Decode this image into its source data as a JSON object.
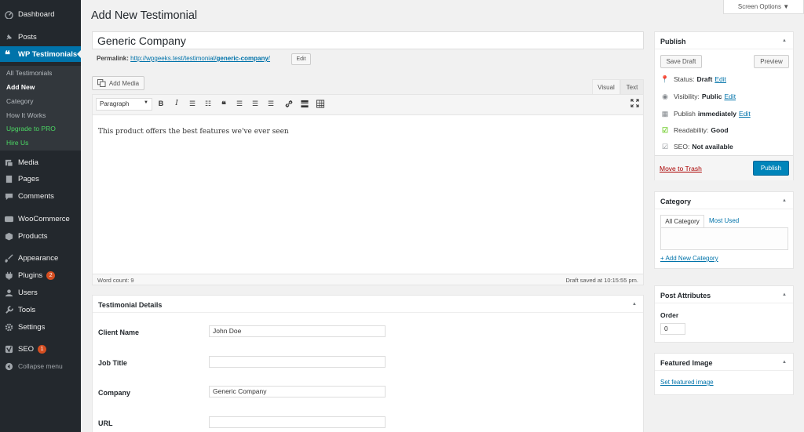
{
  "sidebar": {
    "items": [
      {
        "label": "Dashboard",
        "icon": "dashboard-icon"
      },
      {
        "label": "Posts",
        "icon": "pin-icon"
      },
      {
        "label": "WP Testimonials",
        "icon": "quote-icon"
      },
      {
        "label": "Media",
        "icon": "media-icon"
      },
      {
        "label": "Pages",
        "icon": "page-icon"
      },
      {
        "label": "Comments",
        "icon": "comment-icon"
      },
      {
        "label": "WooCommerce",
        "icon": "woo-icon"
      },
      {
        "label": "Products",
        "icon": "box-icon"
      },
      {
        "label": "Appearance",
        "icon": "brush-icon"
      },
      {
        "label": "Plugins",
        "icon": "plug-icon",
        "badge": "2"
      },
      {
        "label": "Users",
        "icon": "user-icon"
      },
      {
        "label": "Tools",
        "icon": "wrench-icon"
      },
      {
        "label": "Settings",
        "icon": "settings-icon"
      },
      {
        "label": "SEO",
        "icon": "yoast-icon",
        "badge": "1"
      },
      {
        "label": "Collapse menu",
        "icon": "collapse-icon"
      }
    ],
    "submenu": [
      "All Testimonials",
      "Add New",
      "Category",
      "How It Works",
      "Upgrade to PRO",
      "Hire Us"
    ]
  },
  "header": {
    "title": "Add New Testimonial",
    "screen_options": "Screen Options ▼"
  },
  "post": {
    "title": "Generic Company",
    "permalink_label": "Permalink:",
    "permalink_base": "http://wpgeeks.test/testimonial/",
    "permalink_slug": "generic-company",
    "permalink_tail": "/",
    "permalink_edit": "Edit"
  },
  "editor": {
    "add_media": "Add Media",
    "tab_visual": "Visual",
    "tab_text": "Text",
    "format": "Paragraph",
    "content": "This product offers the best features we've ever seen",
    "word_count": "Word count: 9",
    "draft_saved": "Draft saved at 10:15:55 pm."
  },
  "details": {
    "title": "Testimonial Details",
    "client_name_label": "Client Name",
    "client_name_value": "John Doe",
    "job_title_label": "Job Title",
    "job_title_value": "",
    "company_label": "Company",
    "company_value": "Generic Company",
    "url_label": "URL",
    "url_value": ""
  },
  "publish": {
    "title": "Publish",
    "save_draft": "Save Draft",
    "preview": "Preview",
    "status_label": "Status:",
    "status_value": "Draft",
    "visibility_label": "Visibility:",
    "visibility_value": "Public",
    "publish_label": "Publish",
    "publish_value": "immediately",
    "readability_label": "Readability:",
    "readability_value": "Good",
    "seo_label": "SEO:",
    "seo_value": "Not available",
    "edit": "Edit",
    "trash": "Move to Trash",
    "publish_btn": "Publish"
  },
  "category": {
    "title": "Category",
    "tab_all": "All Category",
    "tab_used": "Most Used",
    "add_new": "+ Add New Category"
  },
  "attributes": {
    "title": "Post Attributes",
    "order_label": "Order",
    "order_value": "0"
  },
  "featured": {
    "title": "Featured Image",
    "set_link": "Set featured image"
  },
  "colors": {
    "accent": "#0073aa",
    "sidebar": "#23282d",
    "primary_button": "#0085ba",
    "green_link": "#4cd964",
    "trash": "#a00"
  }
}
